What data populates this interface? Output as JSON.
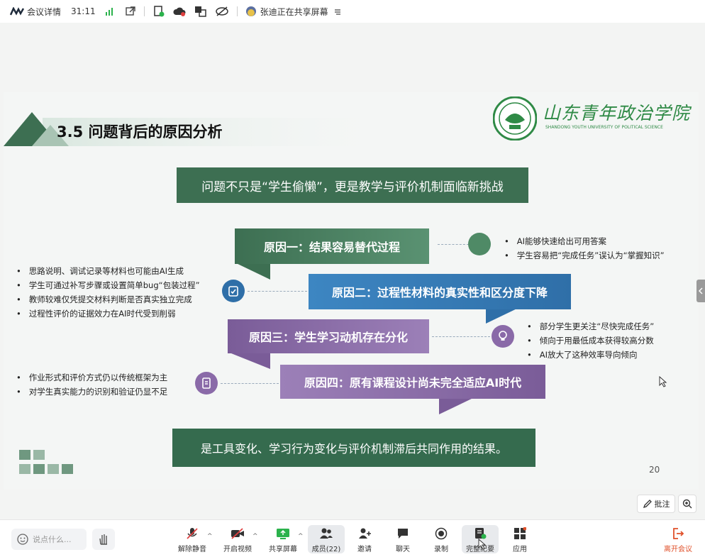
{
  "topbar": {
    "meeting_details": "会议详情",
    "timer": "31:11",
    "sharing_status": "张迪正在共享屏幕"
  },
  "slide": {
    "title": "3.5 问题背后的原因分析",
    "logo_text": "山东青年政治学院",
    "logo_sub": "SHANDONG YOUTH UNIVERSITY OF POLITICAL SCIENCE",
    "headline": "问题不只是“学生偷懒”，更是教学与评价机制面临新挑战",
    "reason1": "原因一：结果容易替代过程",
    "reason2": "原因二：过程性材料的真实性和区分度下降",
    "reason3": "原因三：学生学习动机存在分化",
    "reason4": "原因四：原有课程设计尚未完全适应AI时代",
    "bullets1": [
      "AI能够快速给出可用答案",
      "学生容易把“完成任务”误认为“掌握知识”"
    ],
    "bullets2": [
      "思路说明、调试记录等材料也可能由AI生成",
      "学生可通过补写步骤或设置简单bug“包装过程”",
      "教师较难仅凭提交材料判断是否真实独立完成",
      "过程性评价的证据效力在AI时代受到削弱"
    ],
    "bullets3": [
      "部分学生更关注“尽快完成任务”",
      "倾向于用最低成本获得较高分数",
      "AI放大了这种效率导向倾向"
    ],
    "bullets4": [
      "作业形式和评价方式仍以传统框架为主",
      "对学生真实能力的识别和验证仍显不足"
    ],
    "conclusion": "是工具变化、学习行为变化与评价机制滞后共同作用的结果。",
    "page_number": "20"
  },
  "side_tools": {
    "annotate": "批注"
  },
  "bottombar": {
    "chat_placeholder": "说点什么...",
    "unmute": "解除静音",
    "video": "开启视频",
    "share": "共享屏幕",
    "members": "成员(22)",
    "invite": "邀请",
    "chat": "聊天",
    "record": "录制",
    "summary": "完整纪要",
    "apps": "应用",
    "leave": "离开会议"
  },
  "colors": {
    "green": "#3f7a5a",
    "blue": "#2f6fa8",
    "purple": "#8a6aa8",
    "dark_green": "#356b4e",
    "leave": "#e0512b"
  }
}
